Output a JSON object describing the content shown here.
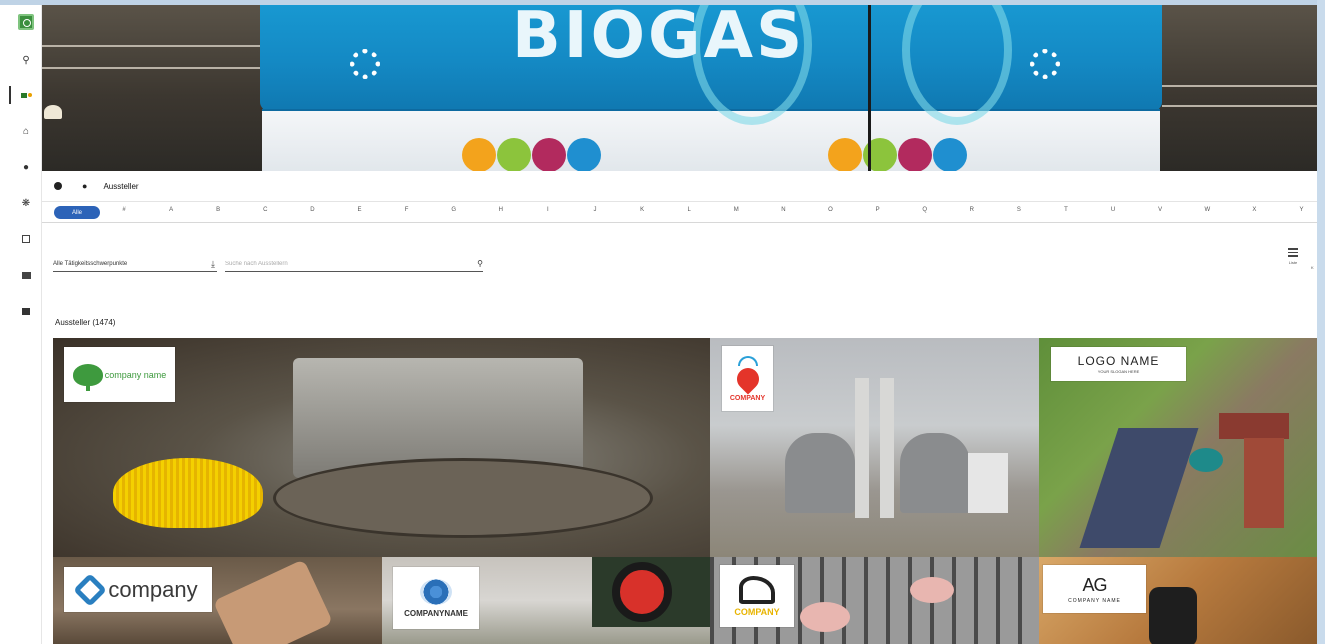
{
  "hero": {
    "banner_text": "BIOGAS"
  },
  "breadcrumb": {
    "label": "Aussteller"
  },
  "alphabet": {
    "all_label": "Alle",
    "letters": [
      "#",
      "A",
      "B",
      "C",
      "D",
      "E",
      "F",
      "G",
      "H",
      "I",
      "J",
      "K",
      "L",
      "M",
      "N",
      "O",
      "P",
      "Q",
      "R",
      "S",
      "T",
      "U",
      "V",
      "W",
      "X",
      "Y"
    ]
  },
  "filters": {
    "category_value": "Alle Tätigkeitsschwerpunkte",
    "search_placeholder": "Suche nach Ausstellern"
  },
  "view": {
    "list_label": "Liste",
    "tile_label": "K"
  },
  "results": {
    "count_label": "Aussteller (1474)"
  },
  "tiles": [
    {
      "logo_text": "company name",
      "logo_color": "#3e9a3e"
    },
    {
      "logo_text": "COMPANY",
      "logo_color": "#e4342a"
    },
    {
      "logo_text": "LOGO NAME",
      "logo_sub": "YOUR SLOGAN HERE",
      "logo_color": "#222222"
    },
    {
      "logo_text": "company",
      "logo_color": "#2a7fc0"
    },
    {
      "logo_text": "COMPANYNAME",
      "logo_color": "#2a6fb8"
    },
    {
      "logo_text": "COMPANY",
      "logo_color": "#e8b400"
    },
    {
      "logo_text": "AG",
      "logo_sub": "COMPANY NAME",
      "logo_color": "#222222"
    }
  ],
  "colors": {
    "accent": "#2c63b8",
    "rail_bg": "#ffffff"
  }
}
